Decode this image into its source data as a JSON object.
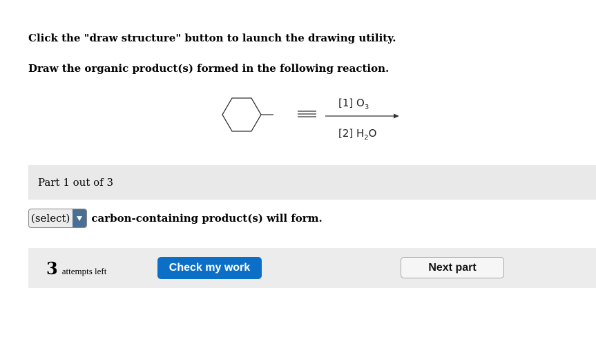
{
  "instructions": {
    "line1": "Click the \"draw structure\" button to launch the drawing utility.",
    "line2": "Draw the organic product(s) formed in the following reaction."
  },
  "reaction": {
    "reagent1_prefix": "[1] O",
    "reagent1_sub": "3",
    "reagent2_prefix": "[2] H",
    "reagent2_sub": "2",
    "reagent2_suffix": "O"
  },
  "part": {
    "label": "Part 1 out of 3"
  },
  "question": {
    "select_value": "(select)",
    "suffix": "carbon-containing product(s) will form."
  },
  "actions": {
    "attempts_count": "3",
    "attempts_text": "attempts left",
    "check_label": "Check my work",
    "next_label": "Next part"
  }
}
